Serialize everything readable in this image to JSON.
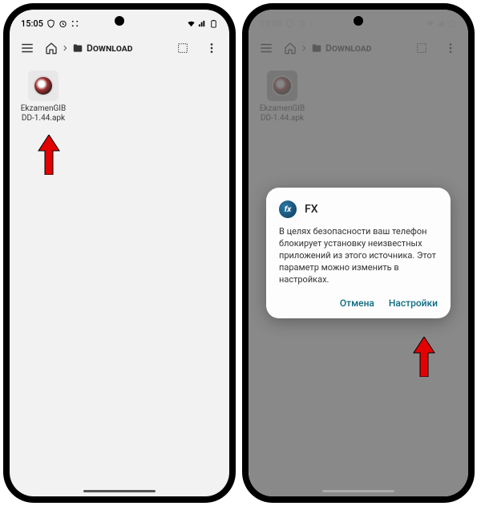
{
  "statusbar": {
    "time": "15:05"
  },
  "breadcrumb": {
    "folder": "Download"
  },
  "file": {
    "name": "EkzamenGIBDD-1.44.apk"
  },
  "dialog": {
    "app": "FX",
    "message": "В целях безопасности ваш телефон блокирует установку неизвестных приложений из этого источника. Этот параметр можно изменить в настройках.",
    "cancel": "Отмена",
    "settings": "Настройки"
  }
}
